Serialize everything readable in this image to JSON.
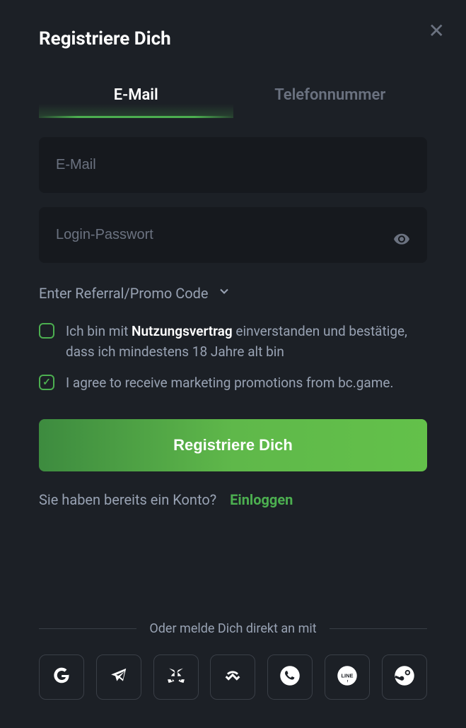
{
  "title": "Registriere Dich",
  "tabs": {
    "email": "E-Mail",
    "phone": "Telefonnummer"
  },
  "fields": {
    "email_placeholder": "E-Mail",
    "password_placeholder": "Login-Passwort"
  },
  "referral": "Enter Referral/Promo Code",
  "checkboxes": {
    "terms_prefix": "Ich bin mit ",
    "terms_bold": "Nutzungsvertrag",
    "terms_suffix": " einverstanden und bestätige, dass ich mindestens 18 Jahre alt bin",
    "marketing": "I agree to receive marketing promotions from bc.game."
  },
  "register_button": "Registriere Dich",
  "login_prompt": "Sie haben bereits ein Konto?",
  "login_action": "Einloggen",
  "divider": "Oder melde Dich direkt an mit"
}
